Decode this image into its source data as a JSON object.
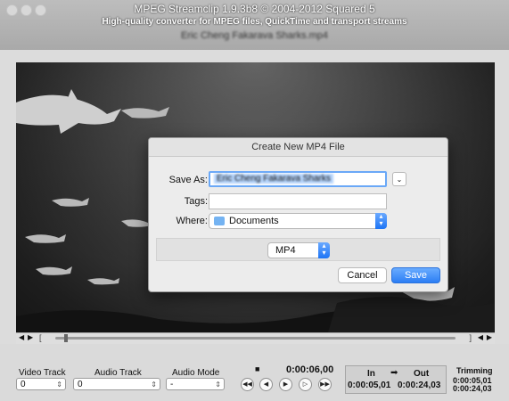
{
  "window": {
    "title": "MPEG Streamclip 1.9.3b8  ©  2004-2012 Squared 5",
    "subtitle": "High-quality converter for MPEG files, QuickTime and transport streams",
    "filename": "Eric Cheng Fakarava Sharks.mp4"
  },
  "dialog": {
    "title": "Create New MP4 File",
    "save_as_label": "Save As:",
    "save_as_value": "Eric Cheng Fakarava Sharks",
    "tags_label": "Tags:",
    "tags_value": "",
    "where_label": "Where:",
    "where_value": "Documents",
    "format_value": "MP4",
    "cancel_label": "Cancel",
    "save_label": "Save"
  },
  "controls": {
    "video_track_label": "Video Track",
    "audio_track_label": "Audio Track",
    "audio_mode_label": "Audio Mode",
    "video_track_value": "0",
    "audio_track_value": "0",
    "audio_mode_value": "-",
    "current_time": "0:00:06,00",
    "stop_glyph": "■",
    "in_label": "In",
    "out_label": "Out",
    "arrow_glyph": "➡",
    "in_time": "0:00:05,01",
    "out_time": "0:00:24,03",
    "trimming_label": "Trimming",
    "trim_start": "0:00:05,01",
    "trim_end": "0:00:24,03",
    "transport": [
      "◀◀",
      "◀",
      "▶",
      "▷",
      "▶▶"
    ]
  },
  "colors": {
    "accent": "#1d74f5",
    "save_button": "#3d8df5"
  }
}
